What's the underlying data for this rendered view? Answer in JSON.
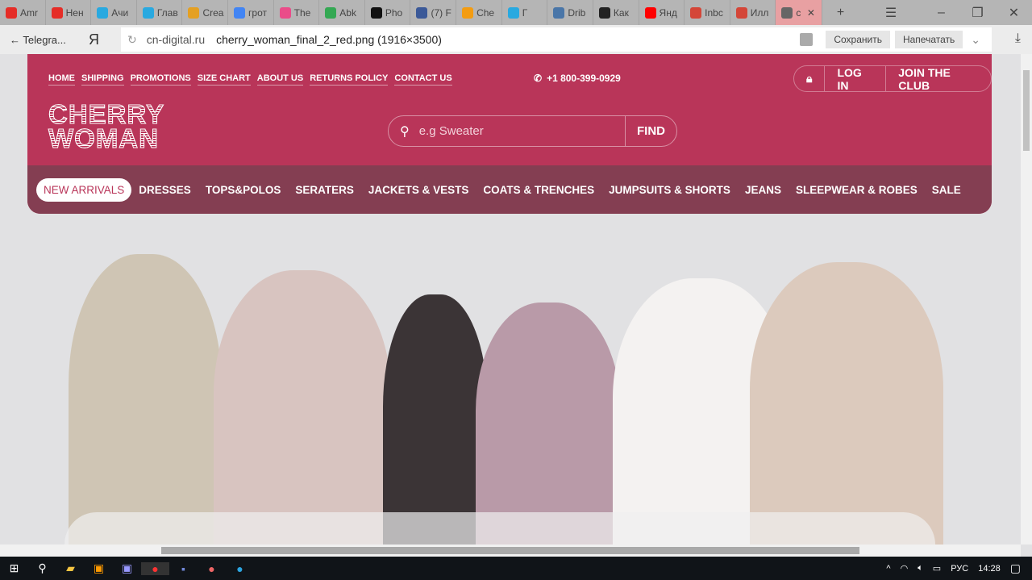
{
  "browser": {
    "tabs": [
      {
        "label": "Amr",
        "icon": "youtube-icon",
        "color": "#e52d27"
      },
      {
        "label": "Нен",
        "icon": "youtube-icon",
        "color": "#e52d27"
      },
      {
        "label": "Ачи",
        "icon": "play-icon",
        "color": "#29a9e0"
      },
      {
        "label": "Глав",
        "icon": "play-icon",
        "color": "#29a9e0"
      },
      {
        "label": "Crea",
        "icon": "slack-icon",
        "color": "#e4a023"
      },
      {
        "label": "грот",
        "icon": "google-icon",
        "color": "#4285f4"
      },
      {
        "label": "The",
        "icon": "dribbble-icon",
        "color": "#ea4c89"
      },
      {
        "label": "Abk",
        "icon": "maps-icon",
        "color": "#34a853"
      },
      {
        "label": "Pho",
        "icon": "medium-icon",
        "color": "#111111"
      },
      {
        "label": "(7) F",
        "icon": "facebook-icon",
        "color": "#3b5998"
      },
      {
        "label": "Che",
        "icon": "colorful-icon",
        "color": "#f39c12"
      },
      {
        "label": "Г",
        "icon": "play-icon",
        "color": "#29a9e0"
      },
      {
        "label": "Drib",
        "icon": "vk-icon",
        "color": "#4a76a8"
      },
      {
        "label": "Как",
        "icon": "quora-icon",
        "color": "#222222"
      },
      {
        "label": "Янд",
        "icon": "yandex-icon",
        "color": "#ff0000"
      },
      {
        "label": "Inbc",
        "icon": "gmail-icon",
        "color": "#d44638"
      },
      {
        "label": "Илл",
        "icon": "gmail-icon",
        "color": "#d44638"
      },
      {
        "label": "c",
        "icon": "file-icon",
        "color": "#666666",
        "active": true
      }
    ],
    "back_label": "Telegra...",
    "yandex_label": "Я",
    "url_host": "cn-digital.ru",
    "url_file": "cherry_woman_final_2_red.png (1916×3500)",
    "save_label": "Сохранить",
    "print_label": "Напечатать"
  },
  "site": {
    "colors": {
      "primary": "#b93559",
      "nav": "#843e52"
    },
    "top_links": [
      "HOME",
      "SHIPPING",
      "PROMOTIONS",
      "SIZE CHART",
      "ABOUT US",
      "RETURNS POLICY",
      "CONTACT US"
    ],
    "phone": "+1 800-399-0929",
    "login": "LOG IN",
    "join": "JOIN THE CLUB",
    "logo": "CHERRY WOMAN",
    "logo_line1": "CHERRY",
    "logo_line2": "WOMAN",
    "search_placeholder": "e.g Sweater",
    "find": "FIND",
    "nav": [
      "NEW ARRIVALS",
      "DRESSES",
      "TOPS&POLOS",
      "SERATERS",
      "JACKETS & VESTS",
      "COATS & TRENCHES",
      "JUMPSUITS & SHORTS",
      "JEANS",
      "SLEEPWEAR & ROBES",
      "SALE"
    ],
    "active_nav": "NEW ARRIVALS"
  },
  "taskbar": {
    "lang": "РУС",
    "time": "14:28"
  }
}
